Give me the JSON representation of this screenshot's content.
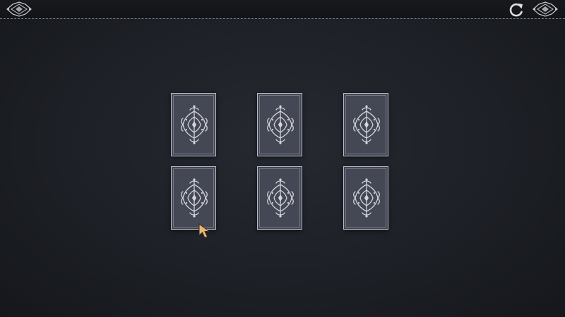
{
  "game": {
    "cards": [
      {
        "state": "face-down",
        "back_icon": "ornament-icon"
      },
      {
        "state": "face-down",
        "back_icon": "ornament-icon"
      },
      {
        "state": "face-down",
        "back_icon": "ornament-icon"
      },
      {
        "state": "face-down",
        "back_icon": "ornament-icon"
      },
      {
        "state": "face-down",
        "back_icon": "ornament-icon"
      },
      {
        "state": "face-down",
        "back_icon": "ornament-icon"
      }
    ],
    "grid": {
      "rows": 2,
      "columns": 3
    }
  },
  "toolbar": {
    "left_icon": "ornament-menu-icon",
    "restart_icon": "restart-icon",
    "right_icon": "ornament-menu-icon"
  },
  "colors": {
    "background": "#1d2026",
    "card_back": "#444754",
    "card_border": "#b9bcc6",
    "ornament": "#d4d6dd",
    "cursor": "#e9b777"
  }
}
